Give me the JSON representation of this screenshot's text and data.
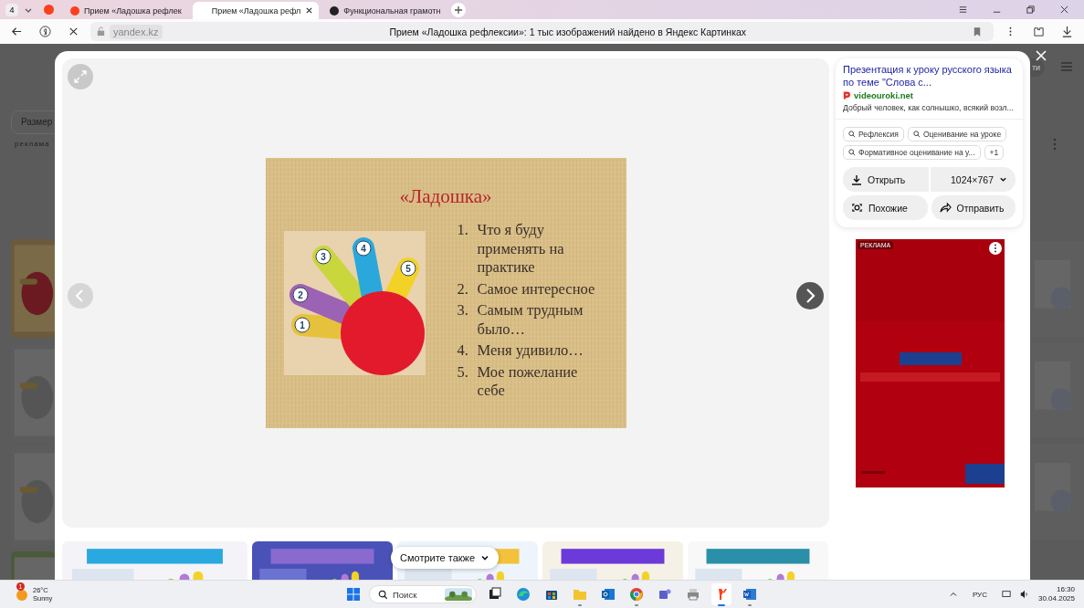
{
  "browser": {
    "tab_count": "4",
    "tabs": [
      {
        "title": "Прием «Ладошка рефлек",
        "selected": false,
        "kind": "yandex"
      },
      {
        "title": "Прием «Ладошка рефл",
        "selected": true,
        "kind": "moon"
      },
      {
        "title": "Функциональная грамотн",
        "selected": false,
        "kind": "dark"
      }
    ],
    "address": "yandex.kz",
    "page_title": "Прием «Ладошка рефлексии»: 1 тыс изображений найдено в Яндекс Картинках"
  },
  "background_page": {
    "size_filter": "Размер",
    "ad_label": "реклама",
    "partial_button": "ти"
  },
  "viewer": {
    "slide": {
      "title": "«Ладошка»",
      "fingers": [
        {
          "number": "1",
          "color": "#e6c23c"
        },
        {
          "number": "2",
          "color": "#9c62b4"
        },
        {
          "number": "3",
          "color": "#c9d63c"
        },
        {
          "number": "4",
          "color": "#2aa8dc"
        },
        {
          "number": "5",
          "color": "#f2d226"
        }
      ],
      "items": [
        {
          "number": "1.",
          "text": "Что я буду применять на практике"
        },
        {
          "number": "2.",
          "text": "Самое интересное"
        },
        {
          "number": "3.",
          "text": "Самым трудным было…"
        },
        {
          "number": "4.",
          "text": "Меня удивило…"
        },
        {
          "number": "5.",
          "text": "Мое пожелание себе"
        }
      ]
    },
    "see_also": "Смотрите также"
  },
  "side_panel": {
    "title": "Презентация к уроку русского языка по теме \"Слова с...",
    "site": "videouroki.net",
    "description": "Добрый человек, как солнышко, всякий возл...",
    "tags": [
      "Рефлексия",
      "Оценивание на уроке",
      "Формативное оценивание на у..."
    ],
    "more_tags": "+1",
    "open_button": "Открыть",
    "size": "1024×767",
    "similar_button": "Похожие",
    "share_button": "Отправить",
    "ad_label": "РЕКЛАМА"
  },
  "taskbar": {
    "notification_count": "1",
    "temperature": "26°C",
    "weather": "Sunny",
    "search_placeholder": "Поиск",
    "apps": [
      {
        "kind": "taskview",
        "running": false,
        "selected": false
      },
      {
        "kind": "edge",
        "running": false,
        "selected": false
      },
      {
        "kind": "store",
        "running": false,
        "selected": false
      },
      {
        "kind": "folder",
        "running": true,
        "selected": false
      },
      {
        "kind": "outlook",
        "running": false,
        "selected": false
      },
      {
        "kind": "chrome",
        "running": true,
        "selected": false
      },
      {
        "kind": "teams",
        "running": false,
        "selected": false
      },
      {
        "kind": "printer",
        "running": false,
        "selected": false
      },
      {
        "kind": "yandex",
        "running": true,
        "selected": true
      },
      {
        "kind": "word",
        "running": true,
        "selected": false
      }
    ],
    "language": "РУС",
    "time": "16:30",
    "date": "30.04.2025"
  }
}
